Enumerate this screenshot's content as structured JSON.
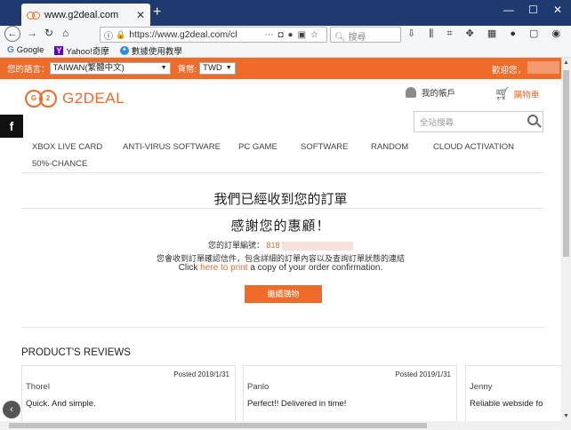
{
  "browser": {
    "tab_title": "www.g2deal.com",
    "tab_close": "✕",
    "new_tab": "+",
    "win_min": "—",
    "win_max": "☐",
    "win_close": "✕",
    "url": "https://www.g2deal.com/cl",
    "search_placeholder": "搜尋",
    "bookmarks": [
      "Google",
      "Yahoo!奇摩",
      "數據使用教學"
    ]
  },
  "site": {
    "language_label": "您的語言：",
    "language_value": "TAIWAN(繁體中文)",
    "currency_label": "貨幣:",
    "currency_value": "TWD",
    "welcome": "歡迎您，",
    "brand": "G2DEAL",
    "account": "我的帳戶",
    "cart": "購物車",
    "search_placeholder": "全站搜尋",
    "fb": "f",
    "menu": [
      "XBOX LIVE CARD",
      "ANTI-VIRUS SOFTWARE",
      "PC GAME",
      "SOFTWARE",
      "RANDOM",
      "CLOUD ACTIVATION",
      "50%-CHANCE"
    ]
  },
  "confirmation": {
    "heading": "我們已經收到您的訂單",
    "thanks": "感謝您的惠顧！",
    "order_label": "您的訂單編號：",
    "order_number": "818",
    "email_note": "您會收到訂單確認信件，包含詳細的訂單內容以及查詢訂單狀態的連結",
    "click_pre": "Click",
    "click_link": "here to print",
    "click_post": "a copy of your order confirmation.",
    "continue_button": "繼續購物"
  },
  "reviews": {
    "title": "PRODUCT'S REVIEWS",
    "items": [
      {
        "date": "Posted 2019/1/31",
        "name": "Thorel",
        "text": "Quick. And simple."
      },
      {
        "date": "Posted 2019/1/31",
        "name": "Panlo",
        "text": "Perfect!! Delivered in time!"
      },
      {
        "date": "",
        "name": "Jenny",
        "text": "Reliable webside fo"
      }
    ]
  }
}
